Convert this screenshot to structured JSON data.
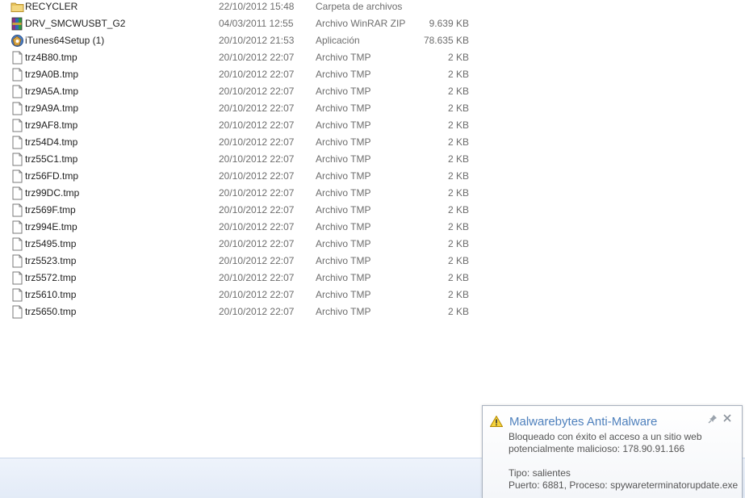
{
  "files": [
    {
      "name": "RECYCLER",
      "date": "22/10/2012 15:48",
      "type": "Carpeta de archivos",
      "size": "",
      "icon": "folder-icon"
    },
    {
      "name": "DRV_SMCWUSBT_G2",
      "date": "04/03/2011 12:55",
      "type": "Archivo WinRAR ZIP",
      "size": "9.639 KB",
      "icon": "winrar-archive-icon"
    },
    {
      "name": "iTunes64Setup (1)",
      "date": "20/10/2012 21:53",
      "type": "Aplicación",
      "size": "78.635 KB",
      "icon": "installer-icon"
    },
    {
      "name": "trz4B80.tmp",
      "date": "20/10/2012 22:07",
      "type": "Archivo TMP",
      "size": "2 KB",
      "icon": "file-icon"
    },
    {
      "name": "trz9A0B.tmp",
      "date": "20/10/2012 22:07",
      "type": "Archivo TMP",
      "size": "2 KB",
      "icon": "file-icon"
    },
    {
      "name": "trz9A5A.tmp",
      "date": "20/10/2012 22:07",
      "type": "Archivo TMP",
      "size": "2 KB",
      "icon": "file-icon"
    },
    {
      "name": "trz9A9A.tmp",
      "date": "20/10/2012 22:07",
      "type": "Archivo TMP",
      "size": "2 KB",
      "icon": "file-icon"
    },
    {
      "name": "trz9AF8.tmp",
      "date": "20/10/2012 22:07",
      "type": "Archivo TMP",
      "size": "2 KB",
      "icon": "file-icon"
    },
    {
      "name": "trz54D4.tmp",
      "date": "20/10/2012 22:07",
      "type": "Archivo TMP",
      "size": "2 KB",
      "icon": "file-icon"
    },
    {
      "name": "trz55C1.tmp",
      "date": "20/10/2012 22:07",
      "type": "Archivo TMP",
      "size": "2 KB",
      "icon": "file-icon"
    },
    {
      "name": "trz56FD.tmp",
      "date": "20/10/2012 22:07",
      "type": "Archivo TMP",
      "size": "2 KB",
      "icon": "file-icon"
    },
    {
      "name": "trz99DC.tmp",
      "date": "20/10/2012 22:07",
      "type": "Archivo TMP",
      "size": "2 KB",
      "icon": "file-icon"
    },
    {
      "name": "trz569F.tmp",
      "date": "20/10/2012 22:07",
      "type": "Archivo TMP",
      "size": "2 KB",
      "icon": "file-icon"
    },
    {
      "name": "trz994E.tmp",
      "date": "20/10/2012 22:07",
      "type": "Archivo TMP",
      "size": "2 KB",
      "icon": "file-icon"
    },
    {
      "name": "trz5495.tmp",
      "date": "20/10/2012 22:07",
      "type": "Archivo TMP",
      "size": "2 KB",
      "icon": "file-icon"
    },
    {
      "name": "trz5523.tmp",
      "date": "20/10/2012 22:07",
      "type": "Archivo TMP",
      "size": "2 KB",
      "icon": "file-icon"
    },
    {
      "name": "trz5572.tmp",
      "date": "20/10/2012 22:07",
      "type": "Archivo TMP",
      "size": "2 KB",
      "icon": "file-icon"
    },
    {
      "name": "trz5610.tmp",
      "date": "20/10/2012 22:07",
      "type": "Archivo TMP",
      "size": "2 KB",
      "icon": "file-icon"
    },
    {
      "name": "trz5650.tmp",
      "date": "20/10/2012 22:07",
      "type": "Archivo TMP",
      "size": "2 KB",
      "icon": "file-icon"
    }
  ],
  "notification": {
    "title": "Malwarebytes Anti-Malware",
    "line1": "Bloqueado con éxito el acceso a un sitio web",
    "line2": "potencialmente malicioso: 178.90.91.166",
    "line3": "Tipo: salientes",
    "line4": "Puerto: 6881, Proceso: spywareterminatorupdate.exe",
    "title_color": "#4f81bd",
    "icons": {
      "warning": "warning-icon",
      "pin": "pin-icon",
      "close": "close-icon"
    }
  }
}
